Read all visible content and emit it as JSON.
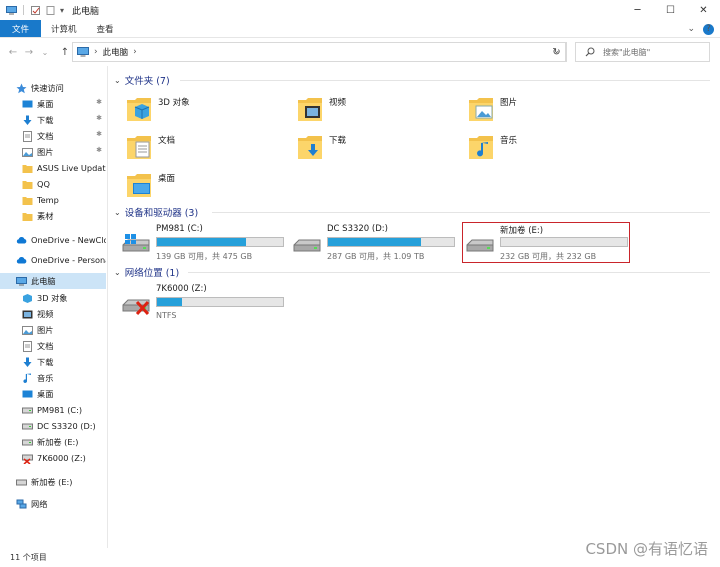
{
  "window": {
    "title": "此电脑",
    "minimize": "─",
    "maximize": "☐",
    "close": "✕"
  },
  "ribbon": {
    "tabs": [
      "文件",
      "计算机",
      "查看"
    ],
    "expand_icon": "chevron-down-icon",
    "help_icon": "?"
  },
  "address": {
    "root_label": "此电脑",
    "back": "←",
    "forward": "→",
    "recent": "⌄",
    "up": "↑",
    "refresh": "↻"
  },
  "search": {
    "placeholder": "搜索\"此电脑\""
  },
  "sidebar": {
    "quick_access": "快速访问",
    "items": [
      {
        "label": "桌面",
        "icon": "desktop-icon",
        "pinned": true
      },
      {
        "label": "下载",
        "icon": "download-icon",
        "pinned": true
      },
      {
        "label": "文档",
        "icon": "document-icon",
        "pinned": true
      },
      {
        "label": "图片",
        "icon": "picture-icon",
        "pinned": true
      },
      {
        "label": "ASUS Live Update",
        "icon": "folder-icon",
        "pinned": false
      },
      {
        "label": "QQ",
        "icon": "folder-icon",
        "pinned": false
      },
      {
        "label": "Temp",
        "icon": "folder-icon",
        "pinned": false
      },
      {
        "label": "素材",
        "icon": "folder-icon",
        "pinned": false
      }
    ],
    "onedrive_1": "OneDrive - NewClo",
    "onedrive_2": "OneDrive - Persona",
    "this_pc": "此电脑",
    "pc_items": [
      {
        "label": "3D 对象",
        "icon": "3d-objects-icon"
      },
      {
        "label": "视频",
        "icon": "video-icon"
      },
      {
        "label": "图片",
        "icon": "picture-icon"
      },
      {
        "label": "文档",
        "icon": "document-icon"
      },
      {
        "label": "下载",
        "icon": "download-icon"
      },
      {
        "label": "音乐",
        "icon": "music-icon"
      },
      {
        "label": "桌面",
        "icon": "desktop-icon"
      },
      {
        "label": "PM981 (C:)",
        "icon": "drive-icon"
      },
      {
        "label": "DC S3320 (D:)",
        "icon": "drive-icon"
      },
      {
        "label": "新加卷 (E:)",
        "icon": "drive-icon"
      },
      {
        "label": "7K6000 (Z:)",
        "icon": "network-drive-icon"
      }
    ],
    "usb_drive": "新加卷 (E:)",
    "network": "网络"
  },
  "groups": {
    "folders": "文件夹 (7)",
    "devices": "设备和驱动器 (3)",
    "network": "网络位置 (1)"
  },
  "folders": [
    {
      "label": "3D 对象",
      "icon": "3d-objects-icon"
    },
    {
      "label": "视频",
      "icon": "video-icon"
    },
    {
      "label": "图片",
      "icon": "picture-icon"
    },
    {
      "label": "文档",
      "icon": "document-icon"
    },
    {
      "label": "下载",
      "icon": "download-icon"
    },
    {
      "label": "音乐",
      "icon": "music-icon"
    },
    {
      "label": "桌面",
      "icon": "desktop-icon"
    }
  ],
  "drives": [
    {
      "name": "PM981 (C:)",
      "free": "139 GB 可用，共 475 GB",
      "used_fraction": 0.71,
      "icon": "windows-drive-icon"
    },
    {
      "name": "DC S3320 (D:)",
      "free": "287 GB 可用，共 1.09 TB",
      "used_fraction": 0.74,
      "icon": "drive-icon"
    },
    {
      "name": "新加卷 (E:)",
      "free": "232 GB 可用，共 232 GB",
      "used_fraction": 0.0,
      "icon": "drive-icon"
    }
  ],
  "network_locations": [
    {
      "name": "7K6000 (Z:)",
      "detail": "NTFS",
      "used_fraction": 0.2,
      "icon": "disconnected-network-drive-icon"
    }
  ],
  "status": {
    "count": "11 个项目"
  },
  "watermark": "CSDN @有语忆语",
  "colors": {
    "accent": "#1979ca",
    "bar_fill": "#26a0da",
    "selected": "#cce4f7",
    "highlight": "#c9252b",
    "group_header": "#1e3287"
  }
}
